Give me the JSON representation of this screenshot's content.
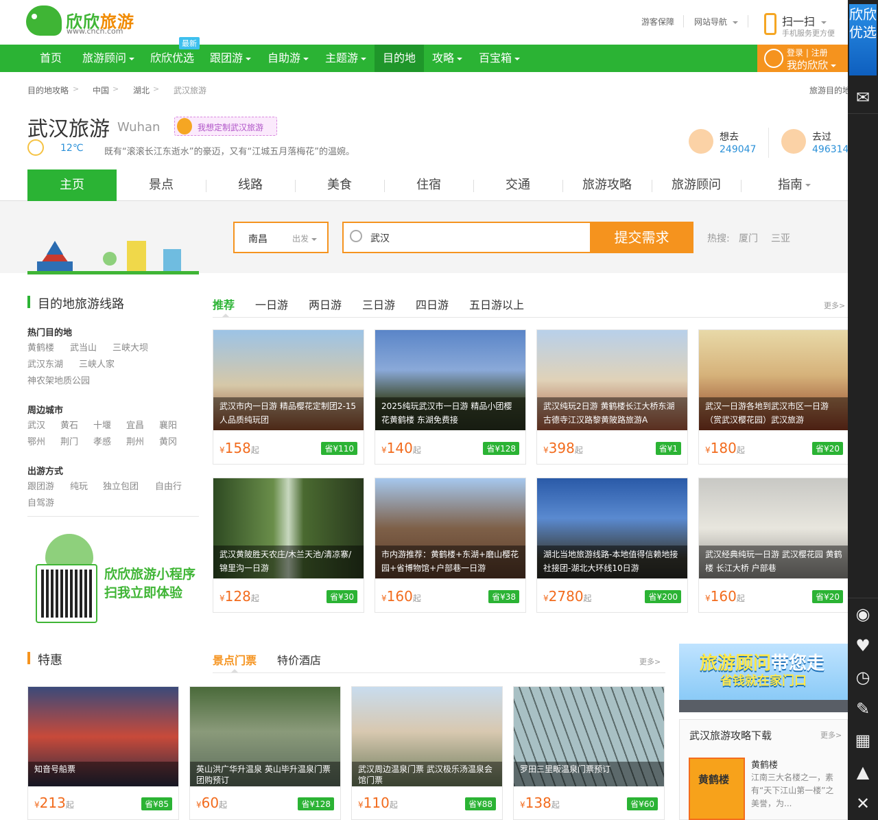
{
  "brand": {
    "name_green": "欣欣",
    "name_orange": "旅游",
    "url": "www.cncn.com"
  },
  "top_links": [
    "游客保障",
    "网站导航"
  ],
  "scan": {
    "title": "扫一扫",
    "subtitle": "手机服务更方便"
  },
  "nav": {
    "items": [
      "首页",
      "旅游顾问",
      "欣欣优选",
      "跟团游",
      "自助游",
      "主题游",
      "目的地",
      "攻略",
      "百宝箱"
    ],
    "badge": "最新"
  },
  "login": {
    "line1": "登录 | 注册",
    "line2": "我的欣欣"
  },
  "breadcrumb": [
    "目的地攻略",
    "中国",
    "湖北",
    "武汉旅游"
  ],
  "breadcrumb_right": "旅游目的地",
  "city": {
    "title": "武汉旅游",
    "en": "Wuhan",
    "custom": "我想定制武汉旅游",
    "temp": "12℃",
    "desc": "既有“滚滚长江东逝水”的豪迈，又有“江城五月落梅花”的温婉。"
  },
  "stats": {
    "want_label": "想去",
    "want_num": "249047",
    "been_label": "去过",
    "been_num": "496314"
  },
  "tabs": [
    "主页",
    "景点",
    "线路",
    "美食",
    "住宿",
    "交通",
    "旅游攻略",
    "旅游顾问",
    "指南"
  ],
  "search": {
    "depart_city": "南昌",
    "depart_label": "出发",
    "value": "武汉",
    "button": "提交需求",
    "hot_label": "热搜:",
    "hot": [
      "厦门",
      "三亚"
    ]
  },
  "routes": {
    "title": "目的地旅游线路",
    "tabs": [
      "推荐",
      "一日游",
      "两日游",
      "三日游",
      "四日游",
      "五日游以上"
    ],
    "more": "更多>",
    "hot_dest_title": "热门目的地",
    "hot_dest": [
      "黄鹤楼",
      "武当山",
      "三峡大坝",
      "武汉东湖",
      "三峡人家",
      "神农架地质公园"
    ],
    "nearby_title": "周边城市",
    "nearby": [
      "武汉",
      "黄石",
      "十堰",
      "宜昌",
      "襄阳",
      "鄂州",
      "荆门",
      "孝感",
      "荆州",
      "黄冈"
    ],
    "mode_title": "出游方式",
    "modes": [
      "跟团游",
      "纯玩",
      "独立包团",
      "自由行",
      "自驾游"
    ],
    "mini_line1": "欣欣旅游小程序",
    "mini_line2": "扫我立即体验",
    "cards": [
      {
        "caption": "武汉市内一日游 精品樱花定制团2-15人品质纯玩团",
        "price": "158",
        "save": "省¥110"
      },
      {
        "caption": "2025纯玩武汉市一日游 精品小团樱花黄鹤楼 东湖免费接",
        "price": "140",
        "save": "省¥128"
      },
      {
        "caption": "武汉纯玩2日游 黄鹤楼长江大桥东湖古德寺江汉路黎黄陂路旅游A",
        "price": "398",
        "save": "省¥1"
      },
      {
        "caption": "武汉一日游各地到武汉市区一日游（赏武汉樱花园）武汉旅游",
        "price": "180",
        "save": "省¥20"
      },
      {
        "caption": "武汉黄陂胜天农庄/木兰天池/清凉寨/锦里沟一日游",
        "price": "128",
        "save": "省¥30"
      },
      {
        "caption": "市内游推荐：黄鹤楼+东湖+磨山樱花园+省博物馆+户部巷一日游",
        "price": "160",
        "save": "省¥38"
      },
      {
        "caption": "湖北当地旅游线路-本地值得信赖地接社接团-湖北大环线10日游",
        "price": "2780",
        "save": "省¥200"
      },
      {
        "caption": "武汉经典纯玩一日游 武汉樱花园 黄鹤楼 长江大桥 户部巷",
        "price": "160",
        "save": "省¥20"
      }
    ]
  },
  "deals": {
    "title": "特惠",
    "tabs": [
      "景点门票",
      "特价酒店"
    ],
    "more": "更多>",
    "cards": [
      {
        "caption": "知音号船票",
        "price": "213",
        "save": "省¥85"
      },
      {
        "caption": "英山洪广华升温泉 英山毕升温泉门票团购预订",
        "price": "60",
        "save": "省¥128"
      },
      {
        "caption": "武汉周边温泉门票 武汉极乐汤温泉会馆门票",
        "price": "110",
        "save": "省¥88"
      },
      {
        "caption": "罗田三里畈温泉门票预订",
        "price": "138",
        "save": "省¥60"
      }
    ]
  },
  "ad": {
    "line1a": "旅游顾问",
    "line1b": "带您走",
    "line2": "省钱就在家门口"
  },
  "download": {
    "title": "武汉旅游攻略下载",
    "more": "更多>",
    "book_title": "黄鹤楼",
    "name": "黄鹤楼",
    "desc": "江南三大名楼之一，素有“天下江山第一楼”之美誉，为..."
  },
  "rail": {
    "top_text": "欣欣优选"
  },
  "currency": "¥",
  "price_suffix": "起"
}
